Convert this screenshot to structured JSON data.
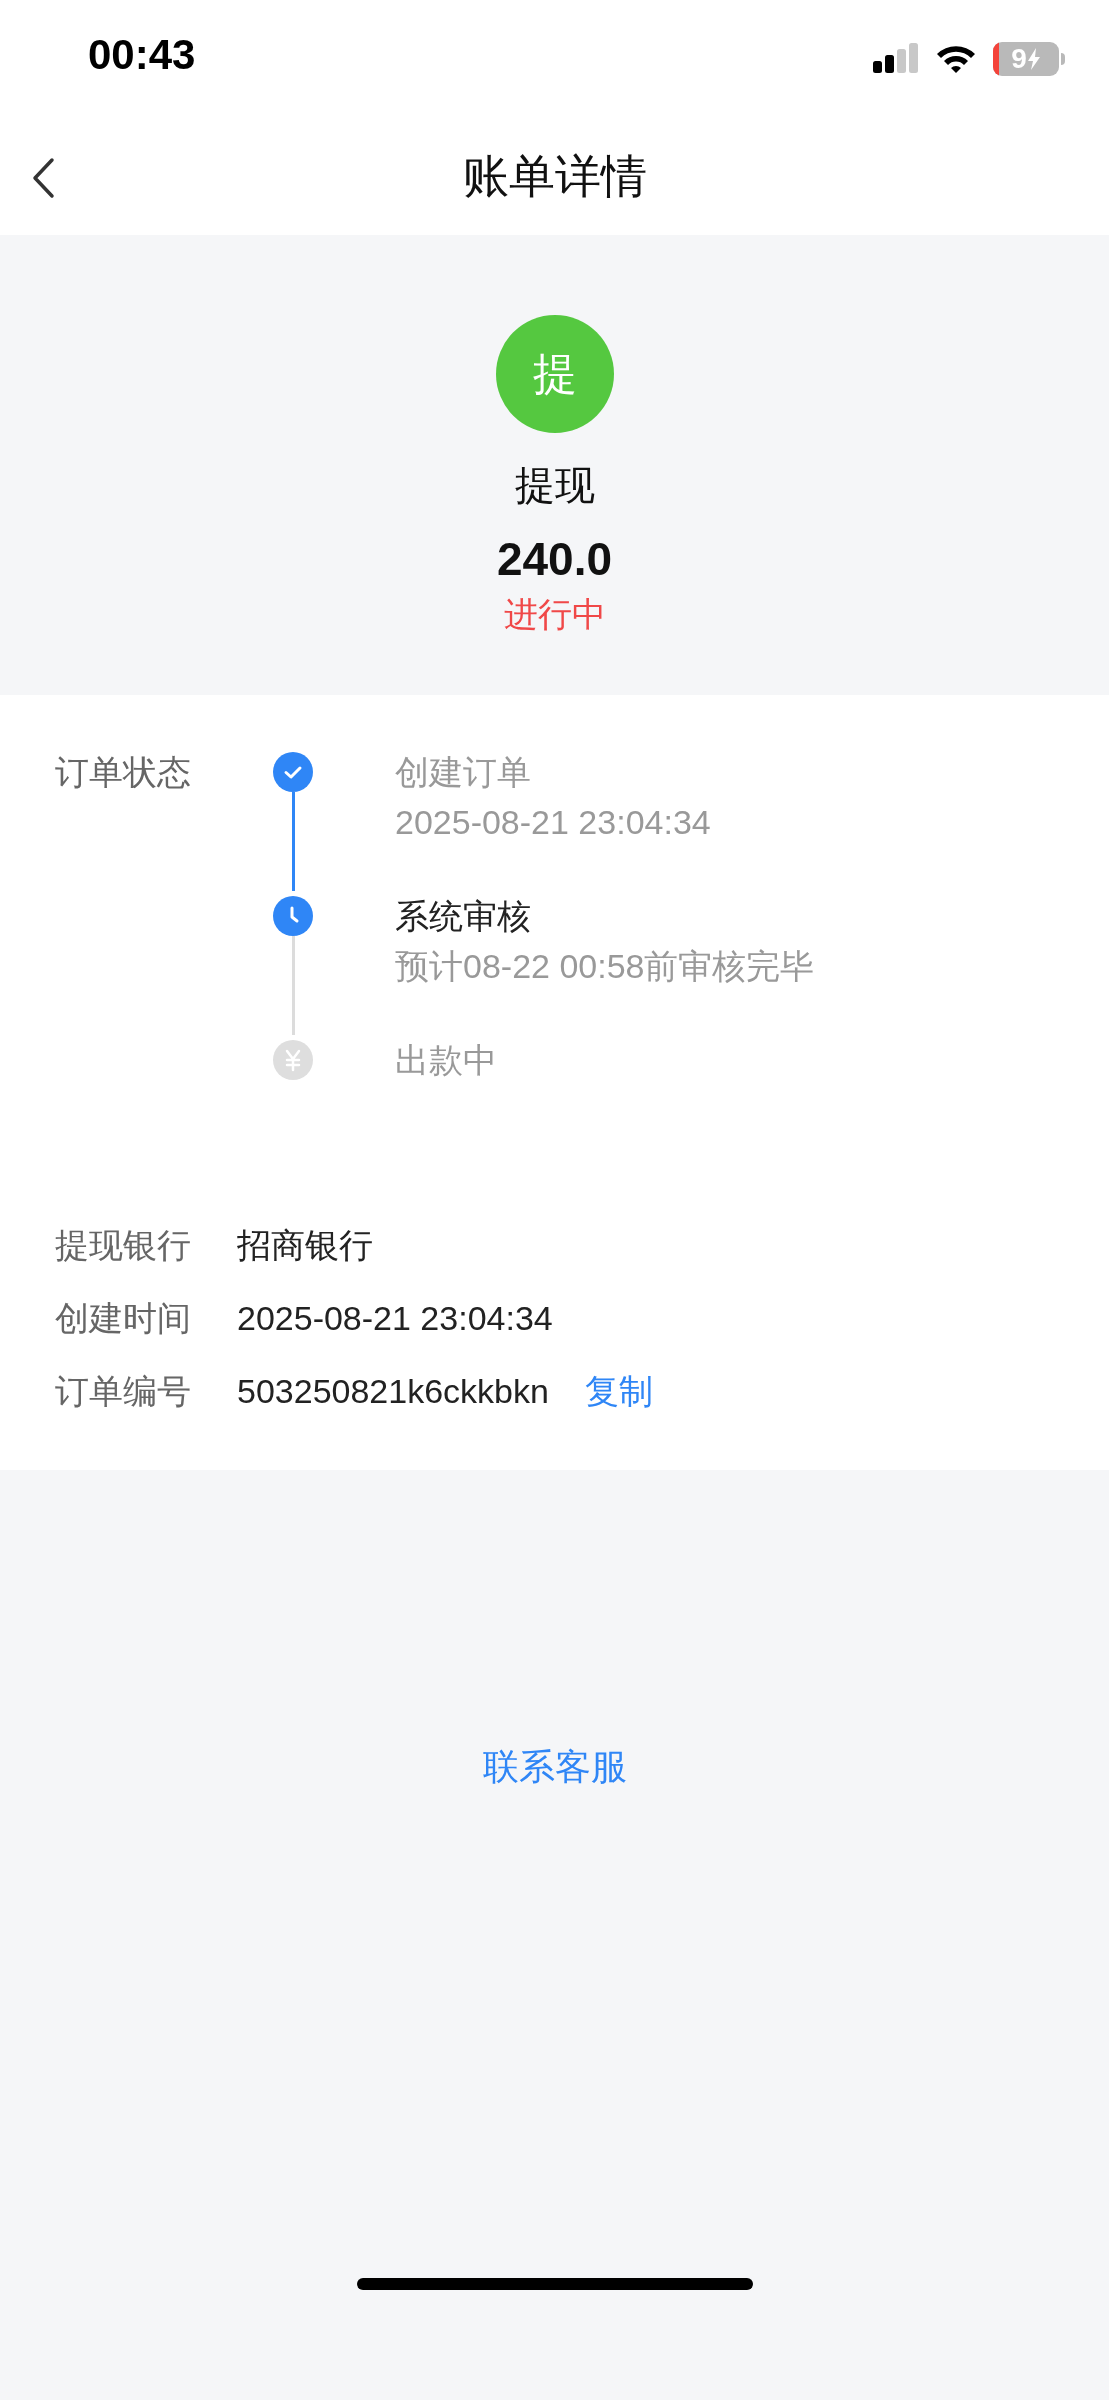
{
  "status_bar": {
    "time": "00:43",
    "battery": "9"
  },
  "header": {
    "title": "账单详情"
  },
  "summary": {
    "badge": "提",
    "type": "提现",
    "amount": "240.0",
    "status": "进行中"
  },
  "order_status": {
    "label": "订单状态",
    "steps": [
      {
        "title": "创建订单",
        "detail": "2025-08-21 23:04:34",
        "kind": "done"
      },
      {
        "title": "系统审核",
        "detail": "预计08-22 00:58前审核完毕",
        "kind": "current"
      },
      {
        "title": "出款中",
        "kind": "pending"
      }
    ]
  },
  "details": [
    {
      "label": "提现银行",
      "value": "招商银行"
    },
    {
      "label": "创建时间",
      "value": "2025-08-21 23:04:34"
    },
    {
      "label": "订单编号",
      "value": "503250821k6ckkbkn",
      "action": "复制"
    }
  ],
  "contact": "联系客服"
}
